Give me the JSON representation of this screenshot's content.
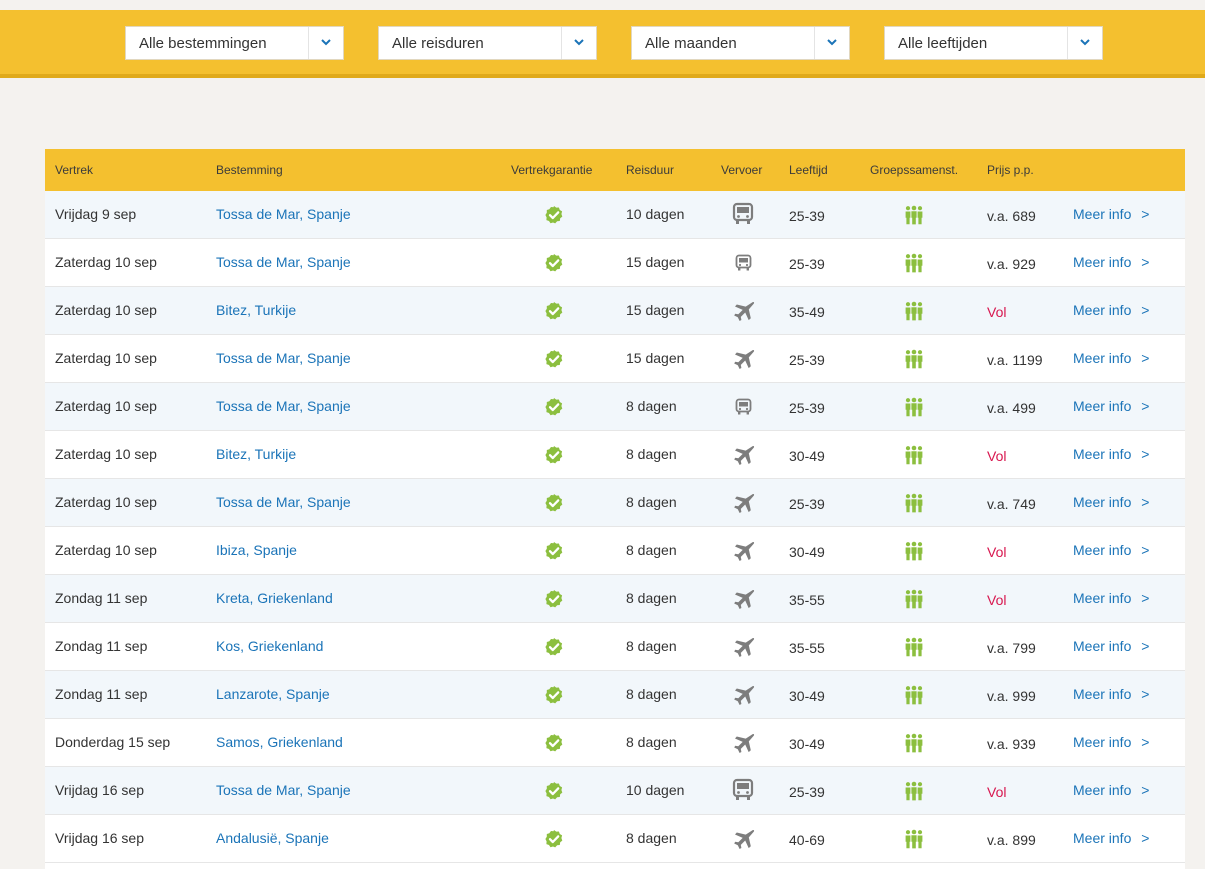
{
  "filters": [
    {
      "label": "Alle bestemmingen",
      "icon": "chevron-down-icon"
    },
    {
      "label": "Alle reisduren",
      "icon": "chevron-down-icon"
    },
    {
      "label": "Alle maanden",
      "icon": "chevron-down-icon"
    },
    {
      "label": "Alle leeftijden",
      "icon": "chevron-down-icon"
    }
  ],
  "columns": [
    "Vertrek",
    "Bestemming",
    "Vertrekgarantie",
    "Reisduur",
    "Vervoer",
    "Leeftijd",
    "Groepssamenst.",
    "Prijs p.p."
  ],
  "colors": {
    "accent": "#f4c02f",
    "link": "#1b74b8",
    "full": "#d8174f",
    "check": "#8cbf3f",
    "group": "#8cbf3f"
  },
  "link_label": "Meer info",
  "rows": [
    {
      "vertrek": "Vrijdag 9 sep",
      "bestemming": "Tossa de Mar, Spanje",
      "reisduur": "10 dagen",
      "vervoer": "bus-icon",
      "leeftijd": "25-39",
      "prijs": "v.a. 689",
      "status": "price"
    },
    {
      "vertrek": "Zaterdag 10 sep",
      "bestemming": "Tossa de Mar, Spanje",
      "reisduur": "15 dagen",
      "vervoer": "bus-small-icon",
      "leeftijd": "25-39",
      "prijs": "v.a. 929",
      "status": "price"
    },
    {
      "vertrek": "Zaterdag 10 sep",
      "bestemming": "Bitez, Turkije",
      "reisduur": "15 dagen",
      "vervoer": "plane-icon",
      "leeftijd": "35-49",
      "prijs": "Vol",
      "status": "full"
    },
    {
      "vertrek": "Zaterdag 10 sep",
      "bestemming": "Tossa de Mar, Spanje",
      "reisduur": "15 dagen",
      "vervoer": "plane-icon",
      "leeftijd": "25-39",
      "prijs": "v.a. 1199",
      "status": "price"
    },
    {
      "vertrek": "Zaterdag 10 sep",
      "bestemming": "Tossa de Mar, Spanje",
      "reisduur": "8 dagen",
      "vervoer": "bus-small-icon",
      "leeftijd": "25-39",
      "prijs": "v.a. 499",
      "status": "price"
    },
    {
      "vertrek": "Zaterdag 10 sep",
      "bestemming": "Bitez, Turkije",
      "reisduur": "8 dagen",
      "vervoer": "plane-icon",
      "leeftijd": "30-49",
      "prijs": "Vol",
      "status": "full"
    },
    {
      "vertrek": "Zaterdag 10 sep",
      "bestemming": "Tossa de Mar, Spanje",
      "reisduur": "8 dagen",
      "vervoer": "plane-icon",
      "leeftijd": "25-39",
      "prijs": "v.a. 749",
      "status": "price"
    },
    {
      "vertrek": "Zaterdag 10 sep",
      "bestemming": "Ibiza, Spanje",
      "reisduur": "8 dagen",
      "vervoer": "plane-icon",
      "leeftijd": "30-49",
      "prijs": "Vol",
      "status": "full"
    },
    {
      "vertrek": "Zondag 11 sep",
      "bestemming": "Kreta, Griekenland",
      "reisduur": "8 dagen",
      "vervoer": "plane-icon",
      "leeftijd": "35-55",
      "prijs": "Vol",
      "status": "full"
    },
    {
      "vertrek": "Zondag 11 sep",
      "bestemming": "Kos, Griekenland",
      "reisduur": "8 dagen",
      "vervoer": "plane-icon",
      "leeftijd": "35-55",
      "prijs": "v.a. 799",
      "status": "price"
    },
    {
      "vertrek": "Zondag 11 sep",
      "bestemming": "Lanzarote, Spanje",
      "reisduur": "8 dagen",
      "vervoer": "plane-icon",
      "leeftijd": "30-49",
      "prijs": "v.a. 999",
      "status": "price"
    },
    {
      "vertrek": "Donderdag 15 sep",
      "bestemming": "Samos, Griekenland",
      "reisduur": "8 dagen",
      "vervoer": "plane-icon",
      "leeftijd": "30-49",
      "prijs": "v.a. 939",
      "status": "price"
    },
    {
      "vertrek": "Vrijdag 16 sep",
      "bestemming": "Tossa de Mar, Spanje",
      "reisduur": "10 dagen",
      "vervoer": "bus-icon",
      "leeftijd": "25-39",
      "prijs": "Vol",
      "status": "full"
    },
    {
      "vertrek": "Vrijdag 16 sep",
      "bestemming": "Andalusië, Spanje",
      "reisduur": "8 dagen",
      "vervoer": "plane-icon",
      "leeftijd": "40-69",
      "prijs": "v.a. 899",
      "status": "price"
    }
  ]
}
